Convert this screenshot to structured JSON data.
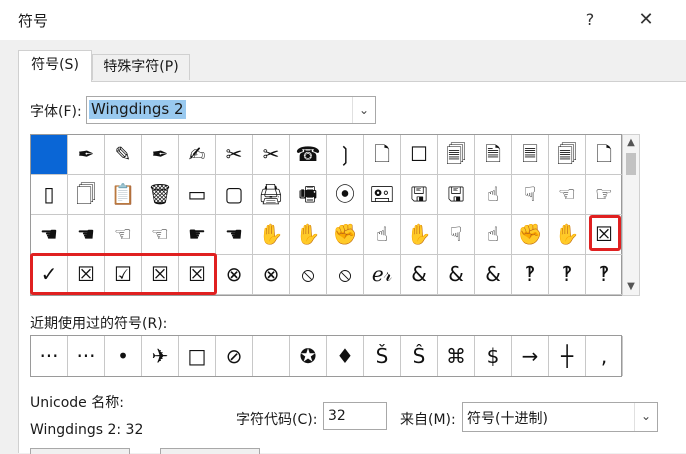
{
  "dialog": {
    "title": "符号",
    "help": "?",
    "close": "✕"
  },
  "tabs": [
    {
      "label": "符号(S)"
    },
    {
      "label": "特殊字符(P)"
    }
  ],
  "font": {
    "label": "字体(F):",
    "value": "Wingdings 2"
  },
  "symbols": [
    "",
    "✒",
    "✎",
    "✒",
    "✍",
    "✂",
    "✂",
    "☎",
    "❳",
    "🗋",
    "☐",
    "🗐",
    "🗎",
    "🗏",
    "🗐",
    "🗋",
    "▯",
    "🗍",
    "📋",
    "🗑",
    "▭",
    "▢",
    "🖨",
    "🖷",
    "⦿",
    "🖭",
    "🖫",
    "🖫",
    "☝",
    "☟",
    "☜",
    "☞",
    "☚",
    "☚",
    "☜",
    "☜",
    "☛",
    "☚",
    "✋",
    "✋",
    "✊",
    "☝",
    "✋",
    "☟",
    "☝",
    "✊",
    "✋",
    "☒",
    "✓",
    "☒",
    "☑",
    "☒",
    "☒",
    "⊗",
    "⊗",
    "⦸",
    "⦸",
    "ℯ𝓇",
    "&",
    "&",
    "&",
    "‽",
    "‽",
    "‽"
  ],
  "recent": {
    "label": "近期使用过的符号(R):",
    "items": [
      "···",
      "···",
      "•",
      "✈",
      "□",
      "⊘",
      "",
      "✪",
      "♦",
      "Š",
      "Ŝ",
      "⌘",
      "$",
      "→",
      "┼",
      ","
    ]
  },
  "unicode": {
    "label": "Unicode 名称:",
    "name": "Wingdings 2: 32"
  },
  "charcode": {
    "label": "字符代码(C):",
    "value": "32"
  },
  "from": {
    "label": "来自(M):",
    "value": "符号(十进制)"
  },
  "colors": {
    "selection": "#0a66d6",
    "highlight": "#e02020",
    "font_highlight": "#99c9ef"
  }
}
